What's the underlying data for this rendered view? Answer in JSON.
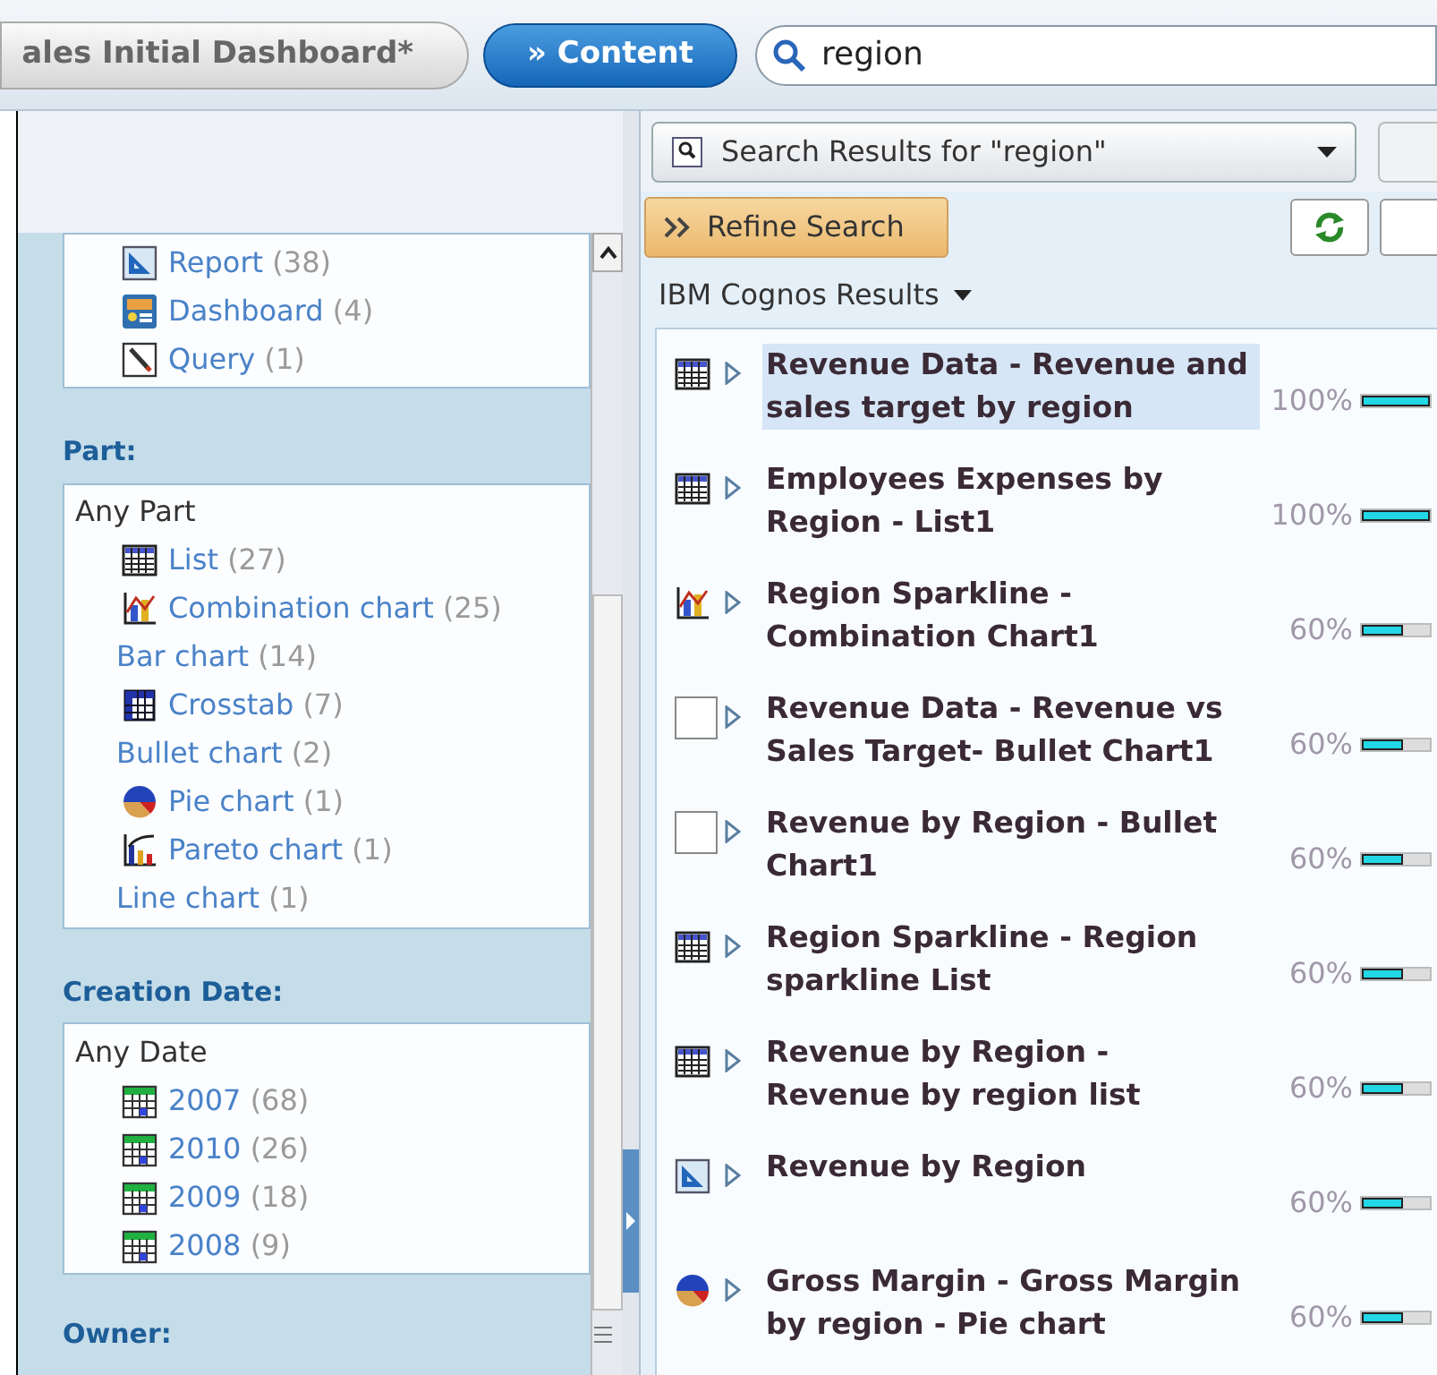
{
  "top_bar": {
    "document_tab": "ales Initial Dashboard*",
    "content_button": "» Content",
    "search": {
      "value": "region"
    }
  },
  "sidebar": {
    "type_items": [
      {
        "kind": "report",
        "label": "Report",
        "count": "(38)"
      },
      {
        "kind": "dashboard",
        "label": "Dashboard",
        "count": "(4)"
      },
      {
        "kind": "query",
        "label": "Query",
        "count": "(1)"
      }
    ],
    "part": {
      "heading": "Part:",
      "any": "Any Part",
      "items": [
        {
          "kind": "list",
          "label": "List",
          "count": "(27)"
        },
        {
          "kind": "combination",
          "label": "Combination chart",
          "count": "(25)"
        },
        {
          "kind": "none",
          "label": "Bar chart",
          "count": "(14)"
        },
        {
          "kind": "crosstab",
          "label": "Crosstab",
          "count": "(7)"
        },
        {
          "kind": "none",
          "label": "Bullet chart",
          "count": "(2)"
        },
        {
          "kind": "pie",
          "label": "Pie chart",
          "count": "(1)"
        },
        {
          "kind": "pareto",
          "label": "Pareto chart",
          "count": "(1)"
        },
        {
          "kind": "none",
          "label": "Line chart",
          "count": "(1)"
        }
      ]
    },
    "creation_date": {
      "heading": "Creation Date:",
      "any": "Any Date",
      "items": [
        {
          "kind": "calendar",
          "label": "2007",
          "count": "(68)"
        },
        {
          "kind": "calendar",
          "label": "2010",
          "count": "(26)"
        },
        {
          "kind": "calendar",
          "label": "2009",
          "count": "(18)"
        },
        {
          "kind": "calendar",
          "label": "2008",
          "count": "(9)"
        }
      ]
    },
    "owner": {
      "heading": "Owner:"
    }
  },
  "results": {
    "scope": "Search Results for \"region\"",
    "refine_button": "Refine Search",
    "source": "IBM Cognos Results",
    "items": [
      {
        "kind": "list",
        "title": "Revenue Data - Revenue and sales target by region",
        "score": "100%",
        "level": 1,
        "selected": true
      },
      {
        "kind": "list",
        "title": "Employees Expenses by Region - List1",
        "score": "100%",
        "level": 1,
        "selected": false
      },
      {
        "kind": "combination",
        "title": "Region Sparkline - Combination Chart1",
        "score": "60%",
        "level": 0.6,
        "selected": false
      },
      {
        "kind": "blank",
        "title": "Revenue Data - Revenue vs Sales Target- Bullet Chart1",
        "score": "60%",
        "level": 0.6,
        "selected": false
      },
      {
        "kind": "blank",
        "title": "Revenue by Region - Bullet Chart1",
        "score": "60%",
        "level": 0.6,
        "selected": false
      },
      {
        "kind": "list",
        "title": "Region Sparkline - Region sparkline List",
        "score": "60%",
        "level": 0.6,
        "selected": false
      },
      {
        "kind": "list",
        "title": "Revenue by Region - Revenue by region list",
        "score": "60%",
        "level": 0.6,
        "selected": false
      },
      {
        "kind": "report",
        "title": "Revenue by Region",
        "score": "60%",
        "level": 0.6,
        "selected": false
      },
      {
        "kind": "pie",
        "title": "Gross Margin - Gross Margin by region - Pie chart",
        "score": "60%",
        "level": 0.6,
        "selected": false
      }
    ]
  }
}
